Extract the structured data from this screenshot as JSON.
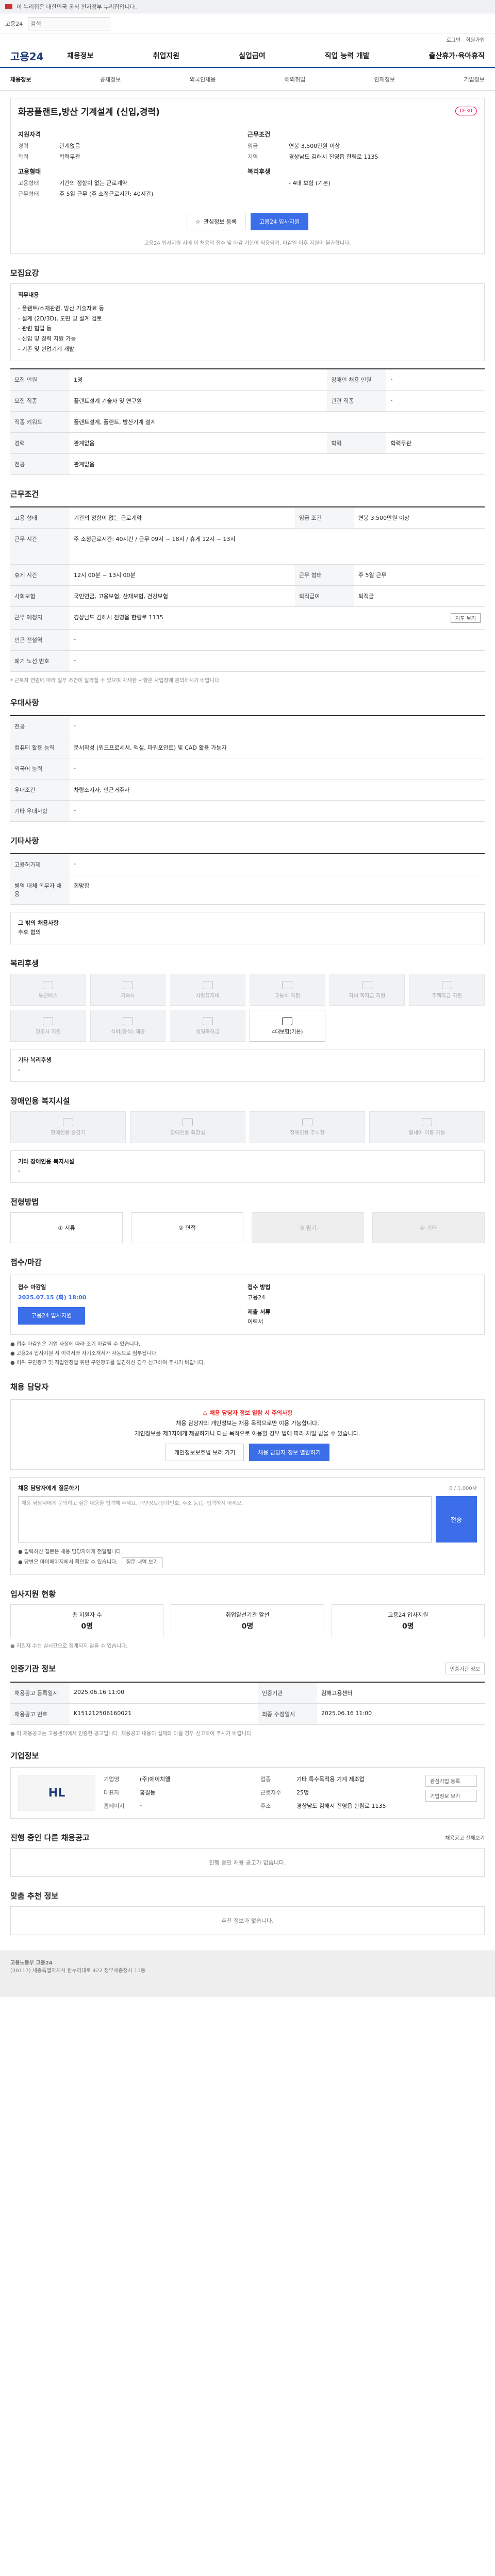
{
  "top": {
    "notice": "이 누리집은 대한민국 공식 전자정부 누리집입니다.",
    "site_mini": "고용24",
    "search_placeholder": "검색"
  },
  "util": [
    "로그인",
    "회원가입"
  ],
  "gnb": {
    "logo": "고용24",
    "menu": [
      "채용정보",
      "취업지원",
      "실업급여",
      "직업 능력 개발",
      "출산휴가·육아휴직"
    ]
  },
  "subnav": [
    "채용정보",
    "공채정보",
    "외국인채용",
    "해외취업",
    "인재정보",
    "기업정보"
  ],
  "hero": {
    "title": "화공플랜트,방산 기계설계 (신입,경력)",
    "badge": "D-30",
    "left_head": "지원자격",
    "left": [
      {
        "k": "경력",
        "v": "관계없음"
      },
      {
        "k": "학력",
        "v": "학력무관"
      }
    ],
    "left_head2": "고용형태",
    "left2": [
      {
        "k": "고용형태",
        "v": "기간의 정함이 없는 근로계약"
      },
      {
        "k": "근무형태",
        "v": "주 5일 근무 (주 소정근로시간: 40시간)"
      }
    ],
    "right_head": "근무조건",
    "right": [
      {
        "k": "임금",
        "v": "연봉 3,500만원 이상"
      },
      {
        "k": "지역",
        "v": "경상남도 김해시 진영읍 한림로 1135"
      }
    ],
    "right_head2": "복리후생",
    "right2": [
      {
        "k": "",
        "v": "- 4대 보험 (기본)"
      }
    ],
    "btn_interest": "관심정보 등록",
    "btn_apply": "고용24 입사지원",
    "note": "고용24 입사지원 시에 이 채용의 접수 및 마감 기한이 적용되며, 마감일 이후 지원이 불가합니다."
  },
  "recruit": {
    "title": "모집요강",
    "box_head": "직무내용",
    "box_lines": [
      "- 플랜트/소재관련, 방산 기술자료 등",
      "- 설계 (2D/3D), 도면 및 설계 검토",
      "- 관련 협업 등",
      "- 신입 및 경력 지원 가능",
      "- 기존 및 현업기계 개발"
    ],
    "rows": [
      {
        "k": "모집 인원",
        "v": "1명",
        "k2": "장애인 채용 인원",
        "v2": "-"
      },
      {
        "k": "모집 직종",
        "v": "플랜트설계 기술자 및 연구원",
        "k2": "관련 직종",
        "v2": "-"
      },
      {
        "k": "직종 키워드",
        "v": "플랜트설계, 플랜트, 방산기계 설계",
        "k2": "",
        "v2": ""
      },
      {
        "k": "경력",
        "v": "관계없음",
        "k2": "학력",
        "v2": "학력무관"
      },
      {
        "k": "전공",
        "v": "관계없음",
        "k2": "",
        "v2": ""
      }
    ]
  },
  "work": {
    "title": "근무조건",
    "rows": [
      {
        "k": "고용 형태",
        "v": "기간의 정함이 없는 근로계약",
        "k2": "임금 조건",
        "v2": "연봉 3,500만원 이상"
      },
      {
        "k": "근무 시간",
        "v": "주 소정근로시간: 40시간 / 근무 09시 ~ 18시 / 휴게 12시 ~ 13시",
        "k2": "",
        "v2": ""
      },
      {
        "k": "휴게 시간",
        "v": "12시 00분 ~ 13시 00분",
        "k2": "근무 형태",
        "v2": "주 5일 근무"
      },
      {
        "k": "사회보험",
        "v": "국민연금, 고용보험, 산재보험, 건강보험",
        "k2": "퇴직급여",
        "v2": "퇴직금"
      },
      {
        "k": "근무 예정지",
        "v": "경상남도 김해시 진영읍 한림로 1135",
        "k2": "",
        "v2": ""
      },
      {
        "k": "인근 전철역",
        "v": "-",
        "k2": "",
        "v2": ""
      },
      {
        "k": "폐기 노선 번호",
        "v": "-",
        "k2": "",
        "v2": ""
      }
    ],
    "map_btn": "지도 보기",
    "note": "* 근로자 연령에 따라 일부 조건이 달라질 수 있으며 자세한 사항은 사업장에 문의하시기 바랍니다."
  },
  "prefer": {
    "title": "우대사항",
    "rows": [
      {
        "k": "전공",
        "v": "-"
      },
      {
        "k": "컴퓨터 활용 능력",
        "v": "문서작성 (워드프로세서, 엑셀, 파워포인트) 및 CAD 활용 가능자"
      },
      {
        "k": "외국어 능력",
        "v": "-"
      },
      {
        "k": "우대조건",
        "v": "차량소지자, 인근거주자"
      },
      {
        "k": "기타 우대사항",
        "v": "-"
      }
    ]
  },
  "etc": {
    "title": "기타사항",
    "rows": [
      {
        "k": "고용허가제",
        "v": "-"
      },
      {
        "k": "병역 대체 복무자 채용",
        "v": "희망함"
      }
    ],
    "sub_head": "그 밖의 채용사항",
    "sub_val": "추후 협의"
  },
  "benefit": {
    "title": "복리후생",
    "cards": [
      {
        "label": "통근버스",
        "on": false
      },
      {
        "label": "기숙사",
        "on": false
      },
      {
        "label": "차량유지비",
        "on": false
      },
      {
        "label": "교통비 지원",
        "on": false
      },
      {
        "label": "자녀 학자금 지원",
        "on": false
      },
      {
        "label": "주택자금 지원",
        "on": false
      },
      {
        "label": "경조사 지원",
        "on": false
      },
      {
        "label": "식비(중식) 제공",
        "on": false
      },
      {
        "label": "생일축하금",
        "on": false
      },
      {
        "label": "4대보험(기본)",
        "on": true
      }
    ],
    "extra_head": "기타 복리후생",
    "extra_val": "-"
  },
  "disabled": {
    "title": "장애인용 복지시설",
    "cards": [
      {
        "label": "장애인용 승강기"
      },
      {
        "label": "장애인용 화장실"
      },
      {
        "label": "장애인용 주차장"
      },
      {
        "label": "휠체어 이동 가능"
      }
    ],
    "extra_head": "기타 장애인용 복지시설",
    "extra_val": "-"
  },
  "process": {
    "title": "전형방법",
    "steps": [
      {
        "label": "① 서류",
        "on": true
      },
      {
        "label": "② 면접",
        "on": true
      },
      {
        "label": "③ 필기",
        "on": false
      },
      {
        "label": "④ 기타",
        "on": false
      }
    ]
  },
  "apply": {
    "title": "접수/마감",
    "rows": [
      {
        "k": "접수 마감일",
        "v": "2025.07.15 (화) 18:00"
      },
      {
        "k": "접수 방법",
        "v": "고용24"
      },
      {
        "k": "제출 서류",
        "v": "이력서"
      }
    ],
    "apply_btn": "고용24 입사지원",
    "notes": [
      "● 접수 마감일은 기업 사정에 따라 조기 마감될 수 있습니다.",
      "● 고용24 입사지원 시 이력서와 자기소개서가 자동으로 첨부됩니다.",
      "● 허위 구인광고 및 직업안정법 위반 구인광고를 발견하신 경우 신고하여 주시기 바랍니다."
    ]
  },
  "contact": {
    "title": "채용 담당자",
    "alert_head": "채용 담당자 정보 열람 시 주의사항",
    "alert_lines": [
      "채용 담당자의 개인정보는 채용 목적으로만 이용 가능합니다.",
      "개인정보를 제3자에게 제공하거나 다른 목적으로 이용할 경우 법에 따라 처벌 받을 수 있습니다."
    ],
    "btn_agree": "개인정보보호법 보러 가기",
    "btn_view": "채용 담당자 정보 열람하기"
  },
  "qa": {
    "head": "채용 담당자에게 질문하기",
    "counter": "0 / 1,000자",
    "placeholder": "채용 담당자에게 문의하고 싶은 내용을 입력해 주세요. 개인정보(전화번호, 주소 등)는 입력하지 마세요.",
    "send": "전송",
    "notes": [
      "● 입력하신 질문은 채용 담당자에게 전달됩니다.",
      "● 답변은 마이페이지에서 확인할 수 있습니다."
    ],
    "link_btn": "질문 내역 보기"
  },
  "stats": {
    "title": "입사지원 현황",
    "items": [
      {
        "k": "총 지원자 수",
        "v": "0명"
      },
      {
        "k": "취업알선기관 알선",
        "v": "0명"
      },
      {
        "k": "고용24 입사지원",
        "v": "0명"
      }
    ],
    "note": "● 지원자 수는 실시간으로 집계되지 않을 수 있습니다."
  },
  "certinfo": {
    "title": "인증기관 정보",
    "btn": "인증기관 정보",
    "rows": [
      {
        "k": "채용공고 등록일시",
        "v": "2025.06.16 11:00",
        "k2": "인증기관",
        "v2": "김해고용센터"
      },
      {
        "k": "채용공고 번호",
        "v": "K151212506160021",
        "k2": "최종 수정일시",
        "v2": "2025.06.16 11:00"
      }
    ],
    "note": "● 이 채용공고는 고용센터에서 인증한 공고입니다. 채용공고 내용이 실제와 다를 경우 신고하여 주시기 바랍니다."
  },
  "company": {
    "title": "기업정보",
    "logo": "HL",
    "rows": [
      {
        "k": "기업명",
        "v": "(주)에이치엘",
        "k2": "업종",
        "v2": "기타 특수목적용 기계 제조업"
      },
      {
        "k": "대표자",
        "v": "홍길동",
        "k2": "근로자수",
        "v2": "25명"
      },
      {
        "k": "홈페이지",
        "v": "-",
        "k2": "주소",
        "v2": "경상남도 김해시 진영읍 한림로 1135"
      }
    ],
    "btns": [
      "관심기업 등록",
      "기업정보 보기"
    ]
  },
  "others": {
    "title": "진행 중인 다른 채용공고",
    "link": "채용공고 전체보기",
    "empty": "진행 중인 채용 공고가 없습니다."
  },
  "recom": {
    "title": "맞춤 추천 정보",
    "empty": "추천 정보가 없습니다."
  },
  "footer": {
    "line1": "고용노동부 고용24",
    "line2": "(30117) 세종특별자치시 한누리대로 422 정부세종청사 11동"
  }
}
